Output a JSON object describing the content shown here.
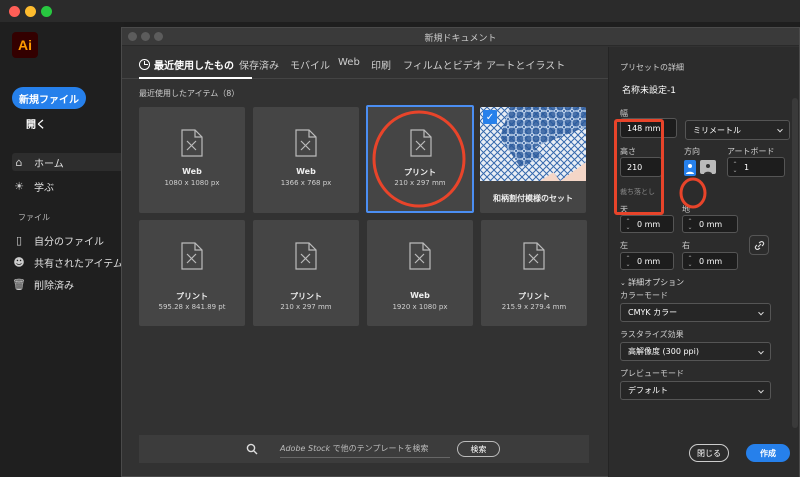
{
  "window": {
    "title": "新規ドキュメント"
  },
  "app": {
    "logo": "Ai",
    "new_file": "新規ファイル",
    "open": "開く",
    "nav": [
      {
        "label": "ホーム",
        "icon": "home-icon"
      },
      {
        "label": "学ぶ",
        "icon": "lightbulb-icon"
      }
    ],
    "files_section": "ファイル",
    "file_nav": [
      {
        "label": "自分のファイル",
        "icon": "document-icon"
      },
      {
        "label": "共有されたアイテム",
        "icon": "users-icon"
      },
      {
        "label": "削除済み",
        "icon": "trash-icon"
      }
    ]
  },
  "tabs": [
    "最近使用したもの",
    "保存済み",
    "モバイル",
    "Web",
    "印刷",
    "フィルムとビデオ",
    "アートとイラスト"
  ],
  "recent": {
    "label": "最近使用したアイテム（8）",
    "items": [
      {
        "name": "Web",
        "size": "1080 x 1080 px"
      },
      {
        "name": "Web",
        "size": "1366 x 768 px"
      },
      {
        "name": "プリント",
        "size": "210 x 297 mm"
      },
      {
        "name": "和柄割付模様のセット",
        "size": ""
      },
      {
        "name": "プリント",
        "size": "595.28 x 841.89 pt"
      },
      {
        "name": "プリント",
        "size": "210 x 297 mm"
      },
      {
        "name": "Web",
        "size": "1920 x 1080 px"
      },
      {
        "name": "プリント",
        "size": "215.9 x 279.4 mm"
      }
    ]
  },
  "search": {
    "brand": "Adobe Stock",
    "placeholder_rest": " で他のテンプレートを検索",
    "button": "検索"
  },
  "details": {
    "header": "プリセットの詳細",
    "name": "名称未設定-1",
    "width_label": "幅",
    "width_value": "148 mm",
    "unit": "ミリメートル",
    "height_label": "高さ",
    "height_value": "210",
    "orientation_label": "方向",
    "artboard_label": "アートボード",
    "artboard_value": "1",
    "bleed_label": "裁ち落とし",
    "top_label": "天",
    "top_value": "0 mm",
    "bottom_label": "地",
    "bottom_value": "0 mm",
    "left_label": "左",
    "left_value": "0 mm",
    "right_label": "右",
    "right_value": "0 mm",
    "advanced_label": "詳細オプション",
    "color_mode_label": "カラーモード",
    "color_mode_value": "CMYK カラー",
    "raster_label": "ラスタライズ効果",
    "raster_value": "高解像度 (300 ppi)",
    "preview_label": "プレビューモード",
    "preview_value": "デフォルト"
  },
  "buttons": {
    "close": "閉じる",
    "create": "作成"
  },
  "colors": {
    "accent": "#2680eb",
    "annotation": "#e8442a"
  }
}
